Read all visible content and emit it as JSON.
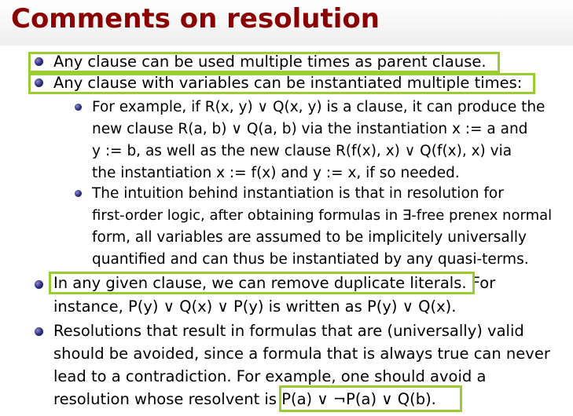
{
  "title": "Comments on resolution",
  "items": [
    {
      "lines": [
        "Any clause can be used multiple times as parent clause."
      ]
    },
    {
      "lines": [
        "Any clause with variables can be instantiated multiple times:"
      ]
    },
    {
      "sub": [
        {
          "lines": [
            "For example, if R(x, y) ∨ Q(x, y) is a clause, it can produce the",
            "new clause R(a, b) ∨ Q(a, b) via the instantiation x := a and",
            "y := b, as well as the new clause R(f(x), x) ∨ Q(f(x), x) via",
            "the instantiation x := f(x) and y := x, if so needed."
          ]
        },
        {
          "lines": [
            "The intuition behind instantiation is that in resolution for",
            "first-order logic, after obtaining formulas in ∃-free prenex normal",
            "form, all variables are assumed to be implicitely universally",
            "quantified and can thus be instantiated by any quasi-terms."
          ]
        }
      ]
    },
    {
      "lines": [
        "In any given clause, we can remove duplicate literals. For",
        "instance, P(y) ∨ Q(x) ∨ P(y) is written as P(y) ∨ Q(x)."
      ]
    },
    {
      "lines": [
        "Resolutions that result in formulas that are (universally) valid",
        "should be avoided, since a formula that is always true can never",
        "lead to a contradiction. For example, one should avoid a",
        "resolution whose resolvent is P(a) ∨ ¬P(a) ∨ Q(b)."
      ]
    }
  ],
  "highlight_color": "#9acd32",
  "title_color": "#8b0000"
}
